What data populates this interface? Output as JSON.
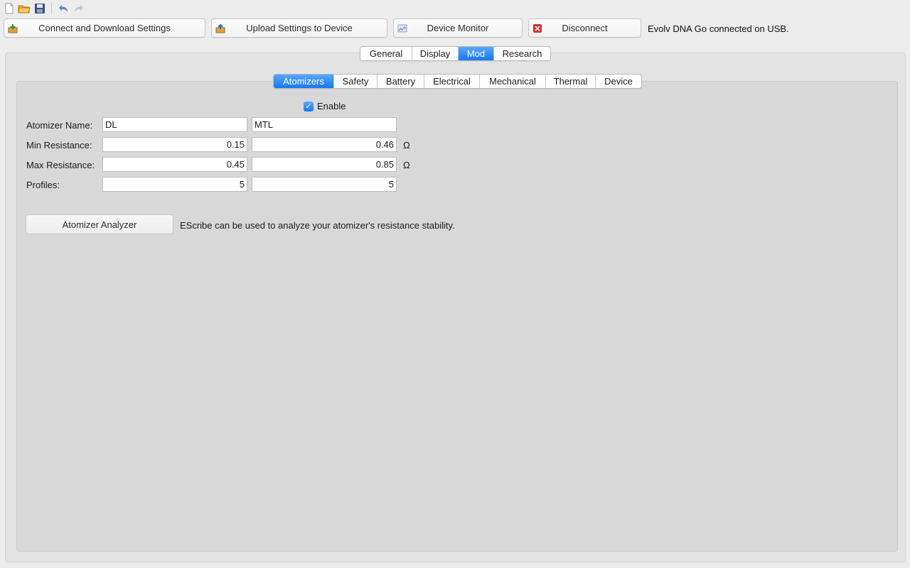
{
  "toolbar_icons": [
    {
      "name": "new-file-icon",
      "title": "New"
    },
    {
      "name": "open-folder-icon",
      "title": "Open"
    },
    {
      "name": "save-icon",
      "title": "Save"
    },
    {
      "name": "undo-icon",
      "title": "Undo"
    },
    {
      "name": "redo-icon",
      "title": "Redo"
    }
  ],
  "actions": {
    "connect_download": "Connect and Download Settings",
    "upload": "Upload Settings to Device",
    "device_monitor": "Device Monitor",
    "disconnect": "Disconnect"
  },
  "status": "Evolv DNA Go connected on USB.",
  "main_tabs": [
    {
      "label": "General",
      "active": false
    },
    {
      "label": "Display",
      "active": false
    },
    {
      "label": "Mod",
      "active": true
    },
    {
      "label": "Research",
      "active": false
    }
  ],
  "sub_tabs": [
    {
      "label": "Atomizers",
      "active": true
    },
    {
      "label": "Safety",
      "active": false
    },
    {
      "label": "Battery",
      "active": false
    },
    {
      "label": "Electrical",
      "active": false
    },
    {
      "label": "Mechanical",
      "active": false
    },
    {
      "label": "Thermal",
      "active": false
    },
    {
      "label": "Device",
      "active": false
    }
  ],
  "atomizers": {
    "enable_label": "Enable",
    "enabled": true,
    "name_label": "Atomizer Name:",
    "name_1": "DL",
    "name_2": "MTL",
    "min_label": "Min Resistance:",
    "min_1": "0.15",
    "min_2": "0.46",
    "max_label": "Max Resistance:",
    "max_1": "0.45",
    "max_2": "0.85",
    "profiles_label": "Profiles:",
    "profiles_1": "5",
    "profiles_2": "5",
    "unit": "Ω",
    "analyzer_button": "Atomizer Analyzer",
    "analyzer_text": "EScribe can be used to analyze your atomizer's resistance stability."
  },
  "colors": {
    "accent": "#1877f2",
    "background": "#ececec",
    "panel": "#d8d8d8"
  }
}
